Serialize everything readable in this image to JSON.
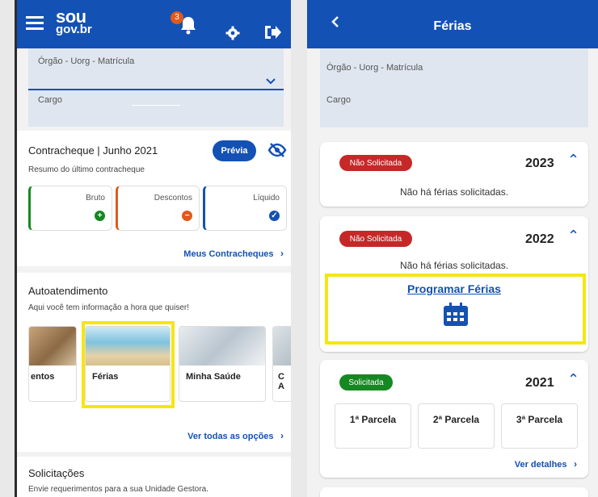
{
  "left": {
    "header": {
      "logo_line1": "sou",
      "logo_line2": "gov.br",
      "notification_count": "3"
    },
    "form": {
      "orgao_label": "Órgão - Uorg - Matrícula",
      "cargo_label": "Cargo"
    },
    "contracheque": {
      "title": "Contracheque | Junho 2021",
      "preview_button": "Prévia",
      "subtitle": "Resumo do último contracheque",
      "bruto": "Bruto",
      "descontos": "Descontos",
      "liquido": "Líquido",
      "link": "Meus Contracheques"
    },
    "autoatendimento": {
      "title": "Autoatendimento",
      "subtitle": "Aqui você tem informação a hora que quiser!",
      "tiles": [
        "entos",
        "Férias",
        "Minha Saúde"
      ],
      "partial_tile": "C\nA",
      "link": "Ver todas as opções"
    },
    "solicitacoes": {
      "title": "Solicitações",
      "subtitle": "Envie requerimentos para a sua Unidade Gestora."
    }
  },
  "right": {
    "header": {
      "title": "Férias"
    },
    "form": {
      "orgao_label": "Órgão - Uorg - Matrícula",
      "cargo_label": "Cargo"
    },
    "years": [
      {
        "badge": "Não Solicitada",
        "year": "2023",
        "message": "Não há férias solicitadas."
      },
      {
        "badge": "Não Solicitada",
        "year": "2022",
        "message": "Não há férias solicitadas.",
        "action": "Programar Férias"
      },
      {
        "badge": "Solicitada",
        "year": "2021",
        "parcelas": [
          "1ª Parcela",
          "2ª Parcela",
          "3ª Parcela"
        ],
        "link": "Ver detalhes"
      }
    ]
  },
  "colors": {
    "primary": "#1351b4",
    "not_requested": "#c62828",
    "requested": "#168821",
    "highlight": "#f5e614",
    "bruto": "#168821",
    "descontos": "#e05a1c",
    "liquido": "#1351b4"
  }
}
